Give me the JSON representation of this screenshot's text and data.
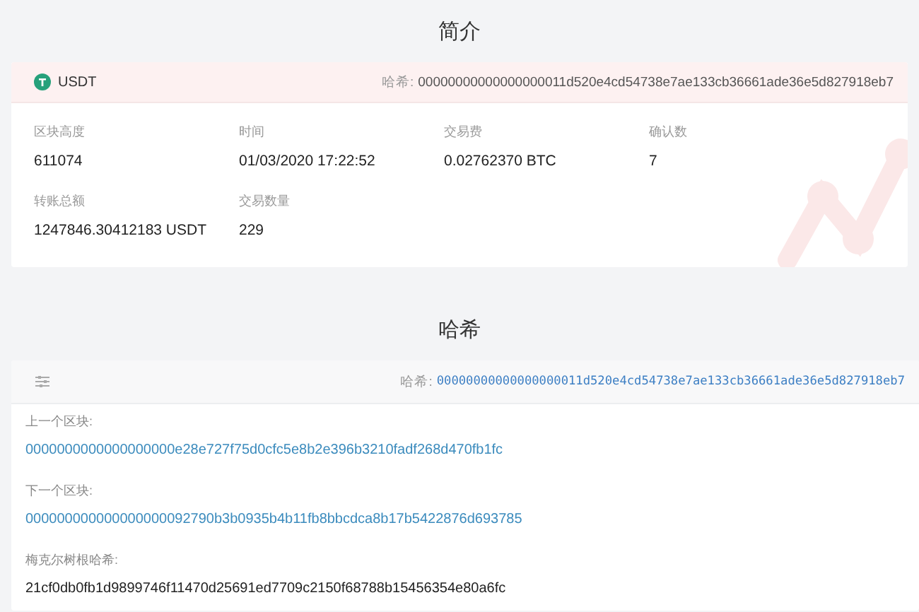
{
  "summary": {
    "title": "简介",
    "coin": "USDT",
    "hash_label": "哈希:",
    "hash": "00000000000000000011d520e4cd54738e7ae133cb36661ade36e5d827918eb7",
    "stats": [
      {
        "label": "区块高度",
        "value": "611074"
      },
      {
        "label": "时间",
        "value": "01/03/2020 17:22:52"
      },
      {
        "label": "交易费",
        "value": "0.02762370 BTC"
      },
      {
        "label": "确认数",
        "value": "7"
      },
      {
        "label": "转账总额",
        "value": "1247846.30412183 USDT"
      },
      {
        "label": "交易数量",
        "value": "229"
      }
    ]
  },
  "hash_section": {
    "title": "哈希",
    "hash_label": "哈希:",
    "hash": "00000000000000000011d520e4cd54738e7ae133cb36661ade36e5d827918eb7",
    "fields": [
      {
        "label": "上一个区块:",
        "value": "0000000000000000000e28e727f75d0cfc5e8b2e396b3210fadf268d470fb1fc",
        "kind": "link"
      },
      {
        "label": "下一个区块:",
        "value": "000000000000000000092790b3b0935b4b11fb8bbcdca8b17b5422876d693785",
        "kind": "link"
      },
      {
        "label": "梅克尔树根哈希:",
        "value": "21cf0db0fb1d9899746f11470d25691ed7709c2150f68788b15456354e80a6fc",
        "kind": "text"
      }
    ]
  }
}
